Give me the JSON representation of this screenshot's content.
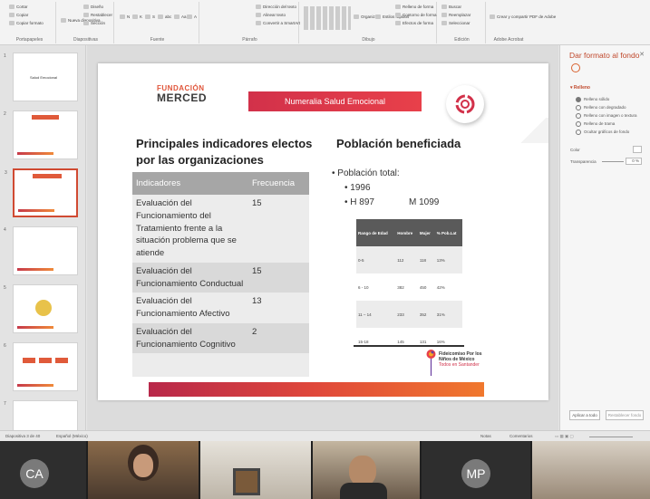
{
  "ribbon": {
    "groups": [
      {
        "name": "Portapapeles",
        "items": [
          "Cortar",
          "Copiar",
          "Copiar formato"
        ]
      },
      {
        "name": "Diapositivas",
        "items": [
          "Nueva diapositiva",
          "Diseño",
          "Restablecer",
          "Sección"
        ]
      },
      {
        "name": "Fuente",
        "items": [
          "N",
          "K",
          "S",
          "abc",
          "Aa",
          "A"
        ]
      },
      {
        "name": "Párrafo",
        "items": [
          "Dirección del texto",
          "Alinear texto",
          "Convertir a SmartArt"
        ]
      },
      {
        "name": "Dibujo",
        "items": [
          "Organizar",
          "Estilos rápidos",
          "Relleno de forma",
          "Contorno de forma",
          "Efectos de forma"
        ]
      },
      {
        "name": "Edición",
        "items": [
          "Buscar",
          "Reemplazar",
          "Seleccionar"
        ]
      },
      {
        "name": "Adobe Acrobat",
        "items": [
          "Crear y compartir PDF de Adobe"
        ]
      }
    ]
  },
  "thumbnails": [
    {
      "num": "1",
      "title": "Salud Emocional"
    },
    {
      "num": "2",
      "title": ""
    },
    {
      "num": "3",
      "title": "Numeralia Salud Emocional"
    },
    {
      "num": "4",
      "title": ""
    },
    {
      "num": "5",
      "title": ""
    },
    {
      "num": "6",
      "title": ""
    },
    {
      "num": "7",
      "title": ""
    }
  ],
  "slide": {
    "logo_top": "FUNDACIÓN",
    "logo_bottom": "MERCED",
    "banner": "Numeralia Salud Emocional",
    "left_heading": "Principales indicadores electos por las organizaciones",
    "right_heading": "Población beneficiada",
    "table": {
      "headers": [
        "Indicadores",
        "Frecuencia"
      ],
      "rows": [
        [
          "Evaluación del Funcionamiento del Tratamiento frente a la situación problema que se atiende",
          "15"
        ],
        [
          "Evaluación del Funcionamiento Conductual",
          "15"
        ],
        [
          "Evaluación del Funcionamiento Afectivo",
          "13"
        ],
        [
          "Evaluación del Funcionamiento Cognitivo",
          "2"
        ],
        [
          "",
          ""
        ]
      ]
    },
    "population": {
      "total_label": "Población total:",
      "total_value": "1996",
      "h_value": "H 897",
      "m_value": "M 1099"
    },
    "age_table": {
      "headers": [
        "Rango de Edad",
        "Hombre",
        "Mujer",
        "% Pob.Lat"
      ],
      "rows": [
        [
          "0-5",
          "112",
          "118",
          "13%"
        ],
        [
          "6 - 10",
          "382",
          "450",
          "42%"
        ],
        [
          "11 – 14",
          "233",
          "352",
          "31%"
        ],
        [
          "15-18",
          "145",
          "131",
          "16%"
        ]
      ]
    },
    "fideicomiso": {
      "line1": "Fideicomiso Por los",
      "line2": "Niños de México",
      "line3": "Todos en Santander"
    }
  },
  "format_pane": {
    "title": "Dar formato al fondo",
    "section": "Relleno",
    "options": [
      "Relleno sólido",
      "Relleno con degradado",
      "Relleno con imagen o textura",
      "Relleno de trama",
      "Ocultar gráficos de fondo"
    ],
    "selected_index": 0,
    "color_label": "Color",
    "transparency_label": "Transparencia",
    "transparency_value": "0 %",
    "apply_all_button": "Aplicar a todo",
    "reset_button": "Restablecer fondo"
  },
  "status_bar": {
    "slide_info": "Diapositiva 3 de 40",
    "language": "Español (México)",
    "notes": "Notas",
    "comments": "Comentarios"
  },
  "participants": [
    {
      "initials": "CA"
    },
    {
      "initials": ""
    },
    {
      "initials": ""
    },
    {
      "initials": ""
    },
    {
      "initials": "MP"
    },
    {
      "initials": ""
    }
  ],
  "colors": {
    "accent": "#d2314a",
    "accent_orange": "#f0782e",
    "pane_title": "#c0482c"
  }
}
